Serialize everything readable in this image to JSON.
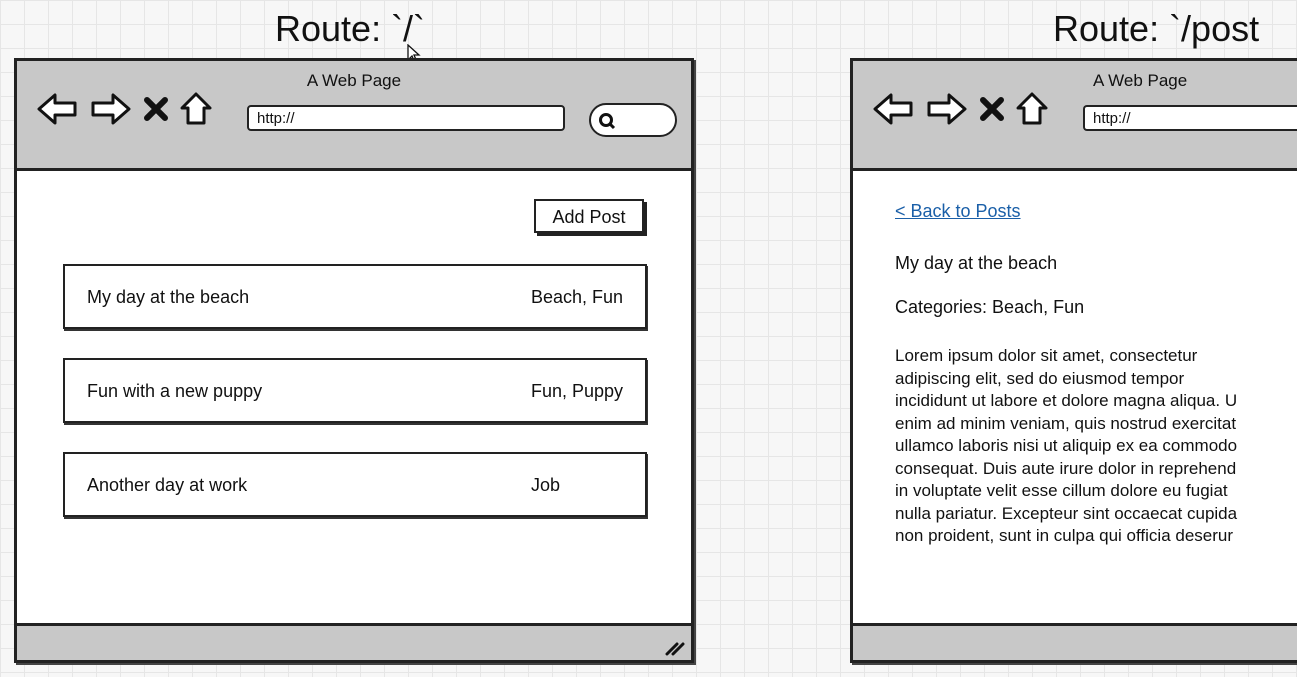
{
  "routes": {
    "home_label": "Route: `/`",
    "post_label": "Route: `/post"
  },
  "home_window": {
    "title": "A Web Page",
    "url_text": "http://",
    "add_post_label": "Add Post",
    "posts": [
      {
        "title": "My day at the beach",
        "categories": "Beach, Fun"
      },
      {
        "title": "Fun with a new puppy",
        "categories": "Fun, Puppy"
      },
      {
        "title": "Another day at work",
        "categories": "Job"
      }
    ]
  },
  "post_window": {
    "title": "A Web Page",
    "url_text": "http://",
    "back_link": "< Back to Posts",
    "post_title": "My day at the beach",
    "categories_line": "Categories: Beach, Fun",
    "body": "Lorem ipsum dolor sit amet, consectetur\nadipiscing elit, sed do eiusmod tempor\nincididunt ut labore et dolore magna aliqua. U\nenim ad minim veniam, quis nostrud exercitat\nullamco laboris nisi ut aliquip ex ea commodo\nconsequat. Duis aute irure dolor in reprehend\nin voluptate velit esse cillum dolore eu fugiat\nnulla pariatur. Excepteur sint occaecat cupida\nnon proident, sunt in culpa qui officia deserur"
  },
  "icons": [
    "back-arrow-icon",
    "forward-arrow-icon",
    "stop-icon",
    "home-icon",
    "search-icon",
    "resize-grip-icon"
  ]
}
